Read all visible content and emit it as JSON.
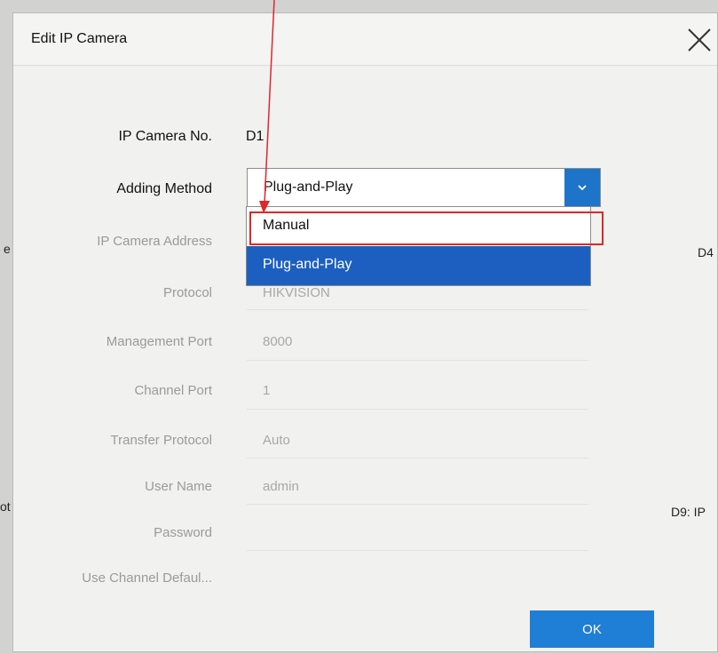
{
  "background": {
    "left_text_1": "e",
    "left_text_2": "ot e",
    "right_text_1": "D4",
    "right_text_2": "D9: IP"
  },
  "dialog": {
    "title": "Edit IP Camera",
    "fields": {
      "camera_no": {
        "label": "IP Camera No.",
        "value": "D1"
      },
      "adding_method": {
        "label": "Adding Method",
        "value": "Plug-and-Play"
      },
      "address": {
        "label": "IP Camera Address"
      },
      "protocol": {
        "label": "Protocol",
        "value": "HIKVISION"
      },
      "management_port": {
        "label": "Management Port",
        "value": "8000"
      },
      "channel_port": {
        "label": "Channel Port",
        "value": "1"
      },
      "transfer_protocol": {
        "label": "Transfer Protocol",
        "value": "Auto"
      },
      "user_name": {
        "label": "User Name",
        "value": "admin"
      },
      "password": {
        "label": "Password"
      },
      "use_channel_default": {
        "label": "Use Channel Defaul..."
      }
    },
    "dropdown_options": [
      "Manual",
      "Plug-and-Play"
    ],
    "ok_label": "OK"
  },
  "colors": {
    "accent": "#1d74c8",
    "selected_option": "#1c5fc0",
    "annotation": "#e0262b"
  }
}
